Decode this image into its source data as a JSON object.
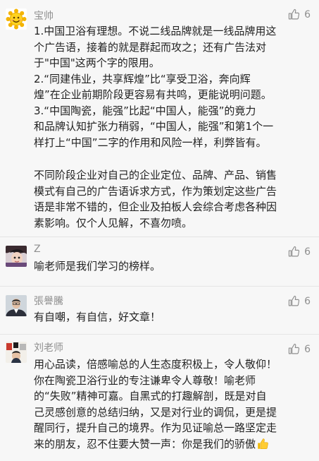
{
  "comments": [
    {
      "author": "宝帅",
      "likes": "6",
      "avatar_icon": "sunflower-avatar",
      "paragraphs": [
        "1.中国卫浴有理想。不说二线品牌就是一线品牌用这\n个广告语，接着的就是群起而攻之；还有广告法对\n于\"中国\"这两个字的限用。\n2.“同建伟业，共享辉煌”比“享受卫浴，奔向辉\n煌”在企业前期阶段更容易有共鸣，更能说明问题。\n3.“中国陶瓷，能强”比起“中国人，能强”的竟力\n和品牌认知扩张力稍弱，“中国人，能强”和第1个一\n样打上“中国”二字的作用和风险一样，利弊皆有。",
        "不同阶段企业对自己的企业定位、品牌、产品、销售\n模式有自己的广告语诉求方式，作为策划定这些广告\n语是非常不错的，但企业及拍板人会综合考虑各种因\n素影响。仅个人见解，不喜勿喷。"
      ]
    },
    {
      "author": "Z",
      "likes": "6",
      "avatar_icon": "cartoon-avatar",
      "paragraphs": [
        "喻老师是我们学习的榜样。"
      ]
    },
    {
      "author": "張譽騰",
      "likes": "6",
      "avatar_icon": "portrait-avatar",
      "paragraphs": [
        "有自嘲，有自信，好文章！"
      ]
    },
    {
      "author": "刘老师",
      "likes": "6",
      "avatar_icon": "photo-avatar",
      "paragraphs": [
        "用心品读，倍感喻总的人生态度积极上，令人敬仰！\n你在陶瓷卫浴行业的专注谦卑令人尊敬！喻老师\n的“失败”精神可嘉。自黑式的打趣解剖，既是对自\n己灵感创意的总结归纳，又是对行业的调侃，更是提\n醒同行，提升自己的境界。作为见证喻总一路坚定走\n来的朋友，忍不住要大赞一声：你是我们的骄傲"
      ],
      "trailing_emoji": "thumbs-up-emoji"
    }
  ],
  "colors": {
    "background": "#f7f7f7",
    "name": "#8f8f8f",
    "text": "#222222",
    "divider": "#e5e5e5"
  }
}
